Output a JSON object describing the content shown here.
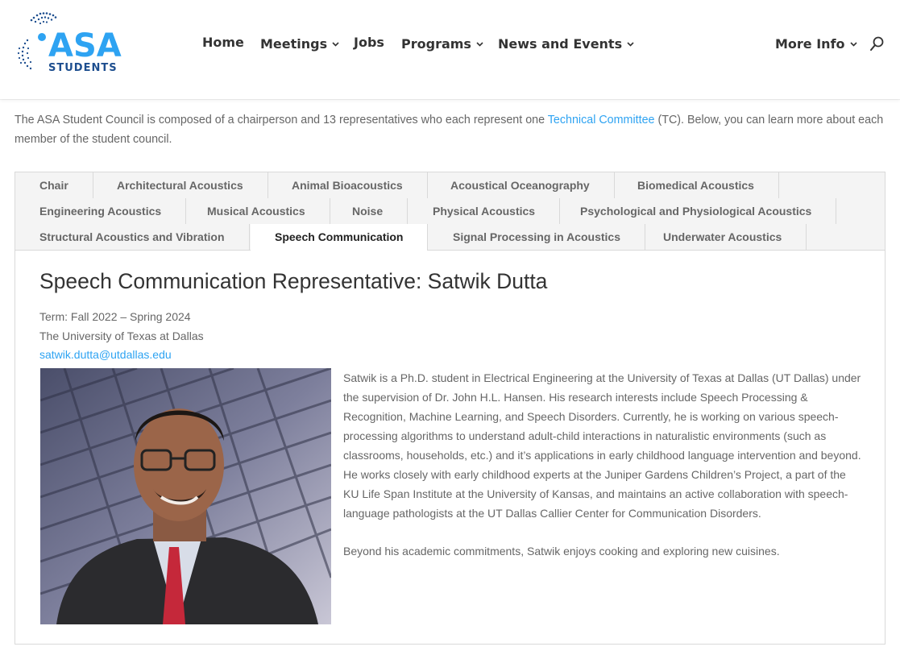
{
  "site": {
    "logo_text_top": "ASA",
    "logo_text_bottom": "STUDENTS",
    "colors": {
      "brand_blue": "#1d4e8f",
      "brand_cyan": "#2ea3f2",
      "link": "#2ea3f2"
    }
  },
  "nav": {
    "items": [
      {
        "label": "Home",
        "has_submenu": false
      },
      {
        "label": "Meetings",
        "has_submenu": true
      },
      {
        "label": "Jobs",
        "has_submenu": false
      },
      {
        "label": "Programs",
        "has_submenu": true
      },
      {
        "label": "News and Events",
        "has_submenu": true
      },
      {
        "label": "More Info",
        "has_submenu": true
      }
    ],
    "search_icon": "search-icon"
  },
  "intro": {
    "text_before": "The ASA Student Council is composed of a chairperson and 13 representatives who each represent one ",
    "link_text": "Technical Committee",
    "text_after": " (TC). Below, you can learn more about each member of the student council."
  },
  "tabs": [
    {
      "label": "Chair"
    },
    {
      "label": "Architectural Acoustics"
    },
    {
      "label": "Animal Bioacoustics"
    },
    {
      "label": "Acoustical Oceanography"
    },
    {
      "label": "Biomedical Acoustics"
    },
    {
      "label": "Engineering Acoustics"
    },
    {
      "label": "Musical Acoustics"
    },
    {
      "label": "Noise"
    },
    {
      "label": "Physical Acoustics"
    },
    {
      "label": "Psychological and Physiological Acoustics"
    },
    {
      "label": "Structural Acoustics and Vibration"
    },
    {
      "label": "Speech Communication",
      "active": true
    },
    {
      "label": "Signal Processing in Acoustics"
    },
    {
      "label": "Underwater Acoustics"
    }
  ],
  "rep": {
    "title": "Speech Communication Representative: Satwik Dutta",
    "term": "Term: Fall 2022 – Spring 2024",
    "school": "The University of Texas at Dallas",
    "email": "satwik.dutta@utdallas.edu",
    "bio_1": "Satwik is a Ph.D. student in Electrical Engineering at the University of Texas at Dallas (UT Dallas) under the supervision of Dr. John H.L. Hansen. His research interests include Speech Processing & Recognition, Machine Learning, and Speech Disorders. Currently, he is working on various speech-processing algorithms to understand adult-child interactions in naturalistic environments (such as classrooms, households, etc.) and it’s applications in early childhood language intervention and beyond. He works closely with early childhood experts at the Juniper Gardens Children’s Project, a part of the KU Life Span Institute at the University of Kansas, and maintains an active collaboration with speech-language pathologists at the UT Dallas Callier Center for Communication Disorders.",
    "bio_2": "Beyond his academic commitments, Satwik enjoys cooking and exploring new cuisines."
  }
}
